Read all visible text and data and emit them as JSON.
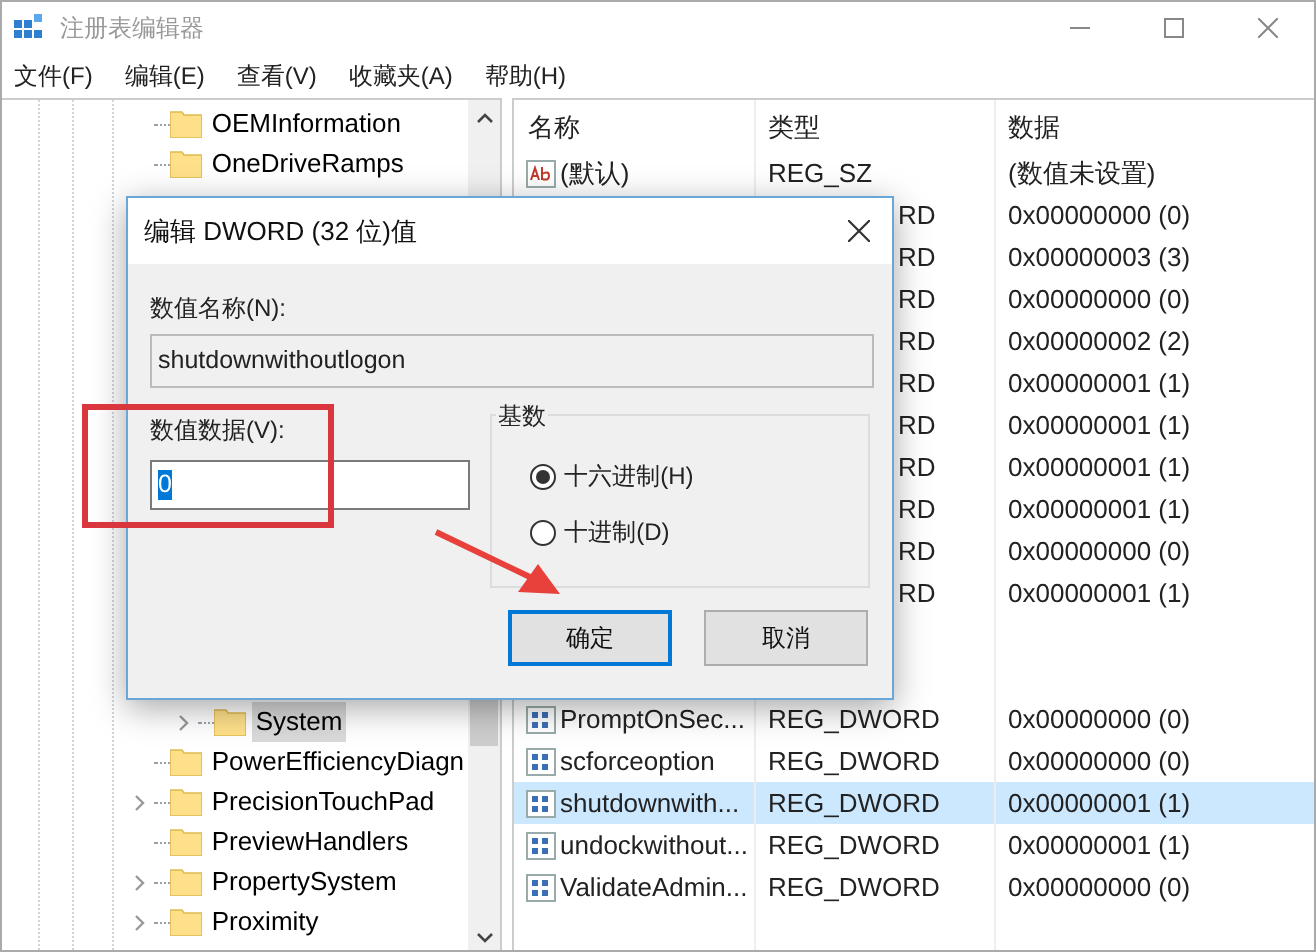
{
  "window": {
    "title": "注册表编辑器"
  },
  "menu": [
    "文件(F)",
    "编辑(E)",
    "查看(V)",
    "收藏夹(A)",
    "帮助(H)"
  ],
  "tree": {
    "items": [
      {
        "label": "OEMInformation",
        "expandable": false,
        "selected": false
      },
      {
        "label": "OneDriveRamps",
        "expandable": false,
        "selected": false
      },
      {
        "children": [
          {
            "label": "System",
            "expandable": true,
            "selected": true
          }
        ]
      },
      {
        "label": "PowerEfficiencyDiagn",
        "expandable": false,
        "selected": false
      },
      {
        "label": "PrecisionTouchPad",
        "expandable": true,
        "selected": false
      },
      {
        "label": "PreviewHandlers",
        "expandable": false,
        "selected": false
      },
      {
        "label": "PropertySystem",
        "expandable": true,
        "selected": false
      },
      {
        "label": "Proximity",
        "expandable": true,
        "selected": false
      }
    ]
  },
  "list": {
    "columns": [
      "名称",
      "类型",
      "数据"
    ],
    "rows": [
      {
        "kind": "string",
        "name": "(默认)",
        "type": "REG_SZ",
        "data": "(数值未设置)",
        "selected": false
      },
      {
        "kind": "dword",
        "type": "RD",
        "data": "0x00000000 (0)",
        "selected": false
      },
      {
        "kind": "dword",
        "type": "RD",
        "data": "0x00000003 (3)",
        "selected": false
      },
      {
        "kind": "dword",
        "type": "RD",
        "data": "0x00000000 (0)",
        "selected": false
      },
      {
        "kind": "dword",
        "type": "RD",
        "data": "0x00000002 (2)",
        "selected": false
      },
      {
        "kind": "dword",
        "type": "RD",
        "data": "0x00000001 (1)",
        "selected": false
      },
      {
        "kind": "dword",
        "type": "RD",
        "data": "0x00000001 (1)",
        "selected": false
      },
      {
        "kind": "dword",
        "type": "RD",
        "data": "0x00000001 (1)",
        "selected": false
      },
      {
        "kind": "dword",
        "type": "RD",
        "data": "0x00000001 (1)",
        "selected": false
      },
      {
        "kind": "dword",
        "type": "RD",
        "data": "0x00000000 (0)",
        "selected": false
      },
      {
        "kind": "dword",
        "type": "RD",
        "data": "0x00000001 (1)",
        "selected": false
      },
      {
        "kind": "gap"
      },
      {
        "kind": "dword",
        "name": "PromptOnSec...",
        "type": "REG_DWORD",
        "data": "0x00000000 (0)",
        "selected": false
      },
      {
        "kind": "dword",
        "name": "scforceoption",
        "type": "REG_DWORD",
        "data": "0x00000000 (0)",
        "selected": false
      },
      {
        "kind": "dword",
        "name": "shutdownwith...",
        "type": "REG_DWORD",
        "data": "0x00000001 (1)",
        "selected": true
      },
      {
        "kind": "dword",
        "name": "undockwithout...",
        "type": "REG_DWORD",
        "data": "0x00000001 (1)",
        "selected": false
      },
      {
        "kind": "dword",
        "name": "ValidateAdmin...",
        "type": "REG_DWORD",
        "data": "0x00000000 (0)",
        "selected": false
      }
    ]
  },
  "dialog": {
    "title": "编辑 DWORD (32 位)值",
    "name_label": "数值名称(N):",
    "name_value": "shutdownwithoutlogon",
    "data_label": "数值数据(V):",
    "data_value": "0",
    "base_label": "基数",
    "bases": [
      {
        "label": "十六进制(H)",
        "selected": true
      },
      {
        "label": "十进制(D)",
        "selected": false
      }
    ],
    "buttons": [
      {
        "label": "确定",
        "default": true
      },
      {
        "label": "取消",
        "default": false
      }
    ]
  }
}
